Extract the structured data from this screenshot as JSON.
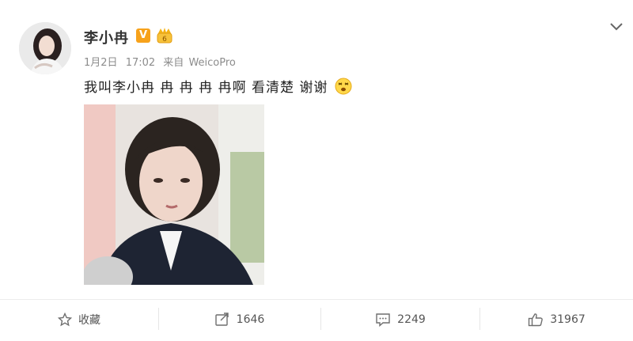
{
  "post": {
    "username": "李小冉",
    "verified_badge": "V",
    "date": "1月2日",
    "time": "17:02",
    "source_prefix": "来自",
    "source": "WeicoPro",
    "text": "我叫李小冉 冉 冉 冉 冉啊 看清楚 谢谢",
    "emoji": "dizzy-face-emoji"
  },
  "actions": {
    "favorite_label": "收藏",
    "repost_count": "1646",
    "comment_count": "2249",
    "like_count": "31967"
  },
  "colors": {
    "verified": "#f7a21b",
    "meta_text": "#8c8c8c",
    "icon_stroke": "#6e6e6e"
  }
}
